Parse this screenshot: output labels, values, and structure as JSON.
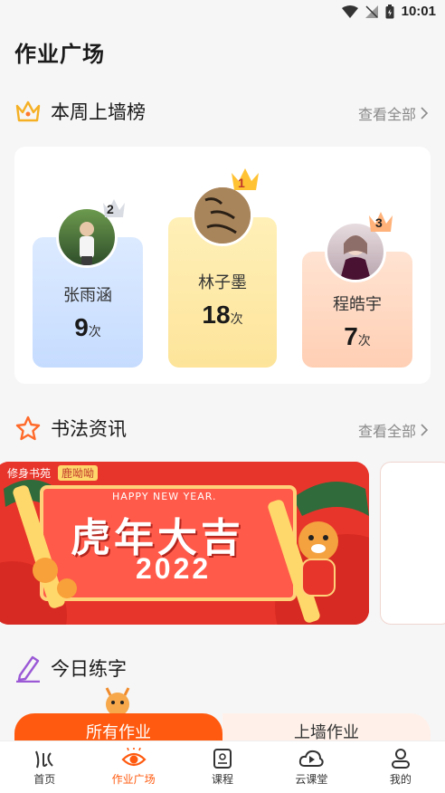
{
  "status": {
    "time": "10:01"
  },
  "page_title": "作业广场",
  "weekly_ranking": {
    "title": "本周上墙榜",
    "see_all": "查看全部",
    "ranks": [
      {
        "rank": "2",
        "name": "张雨涵",
        "count": "9",
        "unit": "次"
      },
      {
        "rank": "1",
        "name": "林子墨",
        "count": "18",
        "unit": "次"
      },
      {
        "rank": "3",
        "name": "程皓宇",
        "count": "7",
        "unit": "次"
      }
    ]
  },
  "news": {
    "title": "书法资讯",
    "see_all": "查看全部",
    "banner": {
      "brand_left": "修身书苑",
      "brand_right": "鹿呦呦",
      "greeting": "HAPPY NEW YEAR.",
      "headline": "虎年大吉",
      "year": "2022"
    }
  },
  "daily_practice": {
    "title": "今日练字",
    "tabs": [
      "所有作业",
      "上墙作业"
    ]
  },
  "bottom_nav": [
    "首页",
    "作业广场",
    "课程",
    "云课堂",
    "我的"
  ],
  "colors": {
    "accent": "#ff5a0f",
    "rank1": "#fde9a9",
    "rank2": "#cfe2ff",
    "rank3": "#ffd9c2"
  }
}
